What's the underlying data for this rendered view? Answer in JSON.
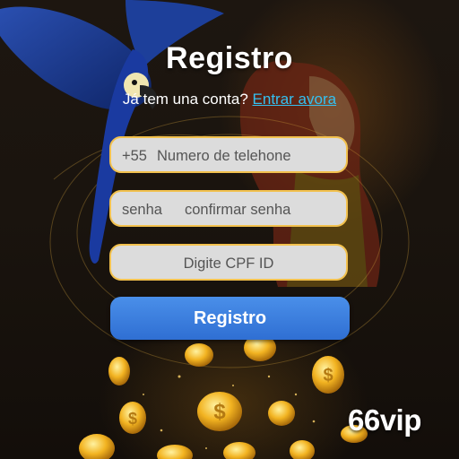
{
  "page": {
    "title": "Registro",
    "subtitle_prefix": "Já tem una conta?",
    "login_link": "Entrar avora"
  },
  "form": {
    "phone": {
      "prefix": "+55",
      "placeholder": "Numero de telehone"
    },
    "password": {
      "label": "senha",
      "confirm_label": "confirmar senha"
    },
    "cpf": {
      "placeholder": "Digite CPF ID"
    },
    "submit_label": "Registro"
  },
  "brand": {
    "name": "66vip"
  },
  "colors": {
    "accent_link": "#34c0f0",
    "field_border": "#f2c14e",
    "button": "#3a7ddd"
  },
  "icons": {
    "coins": "dollar-coin-icon",
    "parrot": "parrot-illustration"
  }
}
